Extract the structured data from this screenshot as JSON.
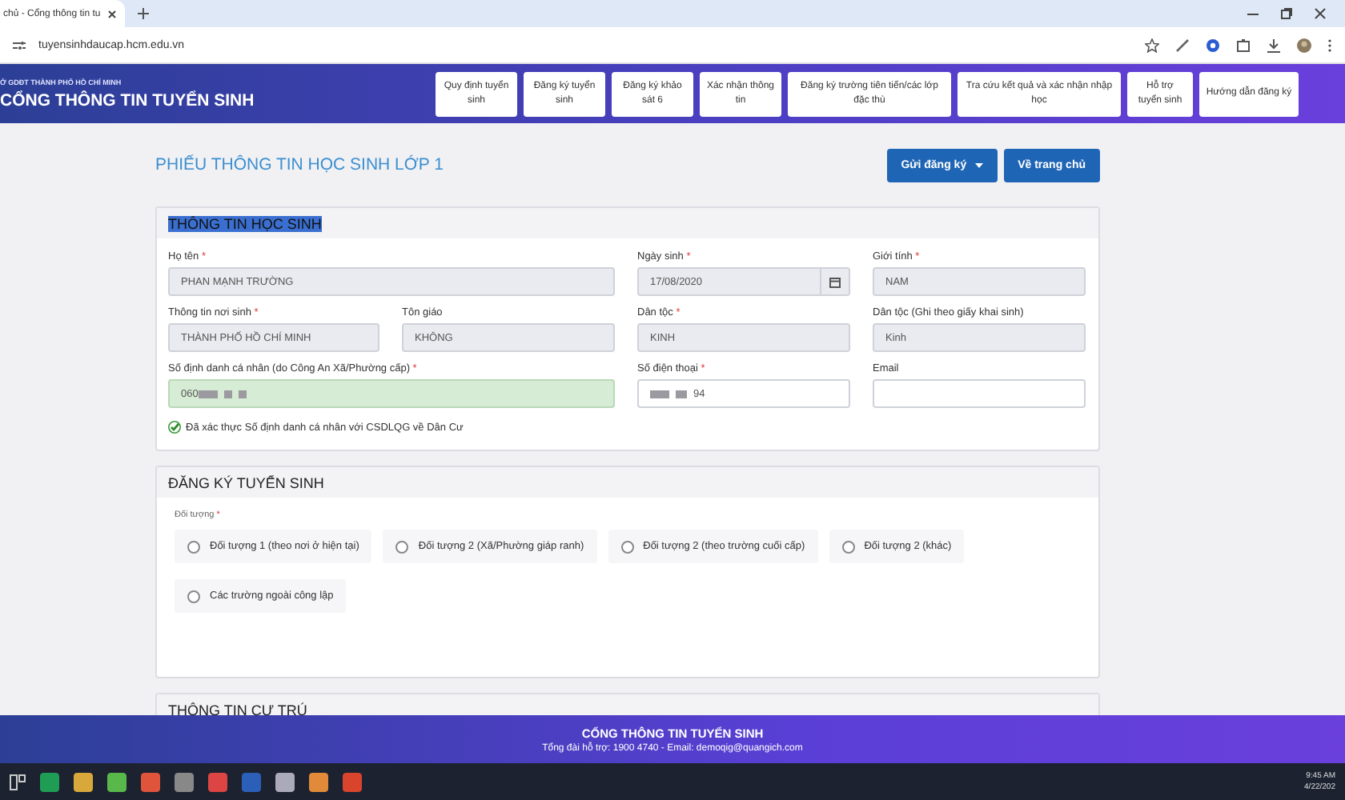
{
  "browser": {
    "tab_title": "chủ - Cổng thông tin tu",
    "url": "tuyensinhdaucap.hcm.edu.vn"
  },
  "header": {
    "subtitle": "Ở GDĐT THÀNH PHỐ HỒ CHÍ MINH",
    "title": "CỔNG THÔNG TIN TUYỂN SINH",
    "nav": [
      "Quy định tuyển sinh",
      "Đăng ký tuyển sinh",
      "Đăng ký khảo sát 6",
      "Xác nhận thông tin",
      "Đăng ký trường tiên tiến/các lớp đặc thù",
      "Tra cứu kết quả và xác nhận nhập học",
      "Hỗ trợ tuyển sinh",
      "Hướng dẫn đăng ký"
    ]
  },
  "required_mark": "*",
  "page_title": "PHIẾU THÔNG TIN HỌC SINH LỚP 1",
  "buttons": [
    {
      "label": "Gửi đăng ký",
      "kind": "dropdown"
    },
    {
      "label": "Về trang chủ",
      "kind": "plain"
    }
  ],
  "student_info": {
    "title": "THÔNG TIN HỌC SINH",
    "fields": [
      {
        "label": "Họ tên",
        "required": true,
        "value": "PHAN MẠNH TRƯỜNG",
        "kind": "readonly"
      },
      {
        "label": "Ngày sinh",
        "required": true,
        "value": "17/08/2020",
        "kind": "date"
      },
      {
        "label": "Giới tính",
        "required": true,
        "value": "NAM",
        "kind": "readonly"
      },
      {
        "label": "Thông tin nơi sinh",
        "required": true,
        "value": "THÀNH PHỐ HỒ CHÍ MINH",
        "kind": "readonly"
      },
      {
        "label": "Tôn giáo",
        "required": false,
        "value": "KHÔNG",
        "kind": "readonly"
      },
      {
        "label": "Dân tộc",
        "required": true,
        "value": "KINH",
        "kind": "readonly"
      },
      {
        "label": "Dân tộc (Ghi theo giấy khai sinh)",
        "required": false,
        "value": "Kinh",
        "kind": "readonly"
      },
      {
        "label": "Số định danh cá nhân (do Công An Xã/Phường cấp)",
        "required": true,
        "value": "060",
        "kind": "verified"
      },
      {
        "label": "Số điện thoại",
        "required": true,
        "value": "94",
        "kind": "masked"
      },
      {
        "label": "Email",
        "required": false,
        "kind": "text"
      }
    ],
    "verified_note": "Đã xác thực Số định danh cá nhân với CSDLQG về Dân Cư"
  },
  "registration": {
    "title": "ĐĂNG KÝ TUYỂN SINH",
    "group_label": "Đối tượng",
    "required": true,
    "options": [
      {
        "label": "Đối tượng 1 (theo nơi ở hiện tại)",
        "selected": false
      },
      {
        "label": "Đối tượng 2 (Xã/Phường giáp ranh)",
        "selected": false
      },
      {
        "label": "Đối tượng 2 (theo trường cuối cấp)",
        "selected": false
      },
      {
        "label": "Đối tượng 2 (khác)",
        "selected": false
      },
      {
        "label": "Các trường ngoài công lập",
        "selected": false
      }
    ]
  },
  "residence": {
    "title": "THÔNG TIN CƯ TRÚ"
  },
  "footer": {
    "title": "CỔNG THÔNG TIN TUYỂN SINH",
    "contact": "Tổng đài hỗ trợ: 1900 4740 - Email: demoqig@quangich.com"
  },
  "taskbar": {
    "time": "9:45 AM",
    "date": "4/22/202"
  }
}
